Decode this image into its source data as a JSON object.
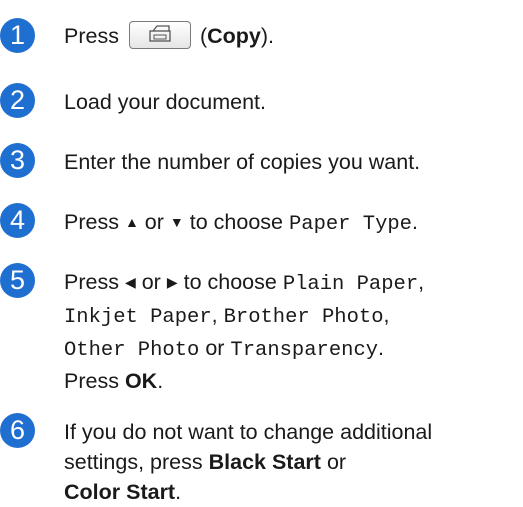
{
  "steps": [
    {
      "number": "1",
      "press": "Press",
      "copy_key_icon": "copy-key-icon",
      "open_paren": "(",
      "copy_label": "Copy",
      "close_paren": ")."
    },
    {
      "number": "2",
      "text": "Load your document."
    },
    {
      "number": "3",
      "text": "Enter the number of copies you want."
    },
    {
      "number": "4",
      "press": "Press",
      "up_arrow": "▲",
      "or": "or",
      "down_arrow": "▼",
      "to_choose": "to choose",
      "menu_item": "Paper Type",
      "period": "."
    },
    {
      "number": "5",
      "press": "Press",
      "left_arrow": "◀",
      "or": "or",
      "right_arrow": "▶",
      "to_choose": "to choose",
      "options": [
        "Plain Paper",
        "Inkjet Paper",
        "Brother Photo",
        "Other Photo",
        "Transparency"
      ],
      "comma": ",",
      "or_word": "or",
      "period": ".",
      "press_ok_prefix": "Press",
      "ok_label": "OK",
      "ok_period": "."
    },
    {
      "number": "6",
      "line1": "If you do not want to change additional",
      "line2_prefix": "settings, press",
      "black_start": "Black Start",
      "or": "or",
      "color_start": "Color Start",
      "period": "."
    }
  ],
  "colors": {
    "badge": "#1f6fd0",
    "text": "#1a1a1a"
  }
}
